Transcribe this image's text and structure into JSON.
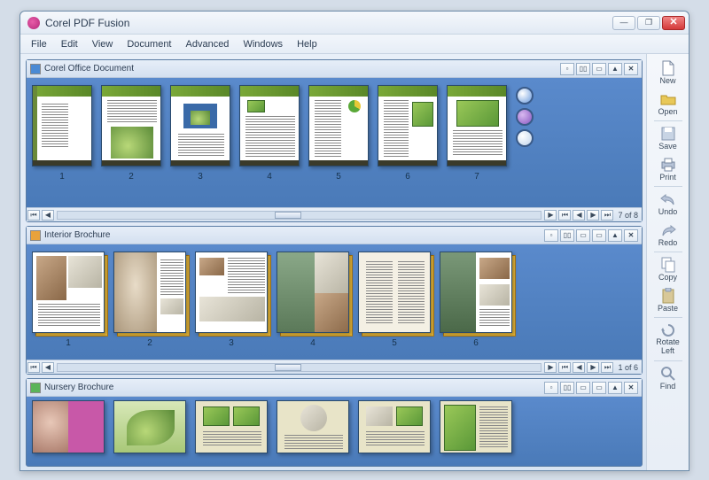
{
  "app": {
    "title": "Corel PDF Fusion"
  },
  "menu": [
    "File",
    "Edit",
    "View",
    "Document",
    "Advanced",
    "Windows",
    "Help"
  ],
  "sidebar": [
    {
      "label": "New",
      "icon": "file-new-icon"
    },
    {
      "label": "Open",
      "icon": "folder-open-icon"
    },
    {
      "label": "Save",
      "icon": "disk-icon"
    },
    {
      "label": "Print",
      "icon": "printer-icon"
    },
    {
      "label": "Undo",
      "icon": "undo-icon"
    },
    {
      "label": "Redo",
      "icon": "redo-icon"
    },
    {
      "label": "Copy",
      "icon": "copy-icon"
    },
    {
      "label": "Paste",
      "icon": "paste-icon"
    },
    {
      "label": "Rotate Left",
      "icon": "rotate-left-icon"
    },
    {
      "label": "Find",
      "icon": "find-icon"
    }
  ],
  "documents": [
    {
      "title": "Corel Office Document",
      "color": "blue",
      "pages": [
        "1",
        "2",
        "3",
        "4",
        "5",
        "6",
        "7"
      ],
      "pager": "7 of 8",
      "showViewBtns": true
    },
    {
      "title": "Interior Brochure",
      "color": "orange",
      "pages": [
        "1",
        "2",
        "3",
        "4",
        "5",
        "6"
      ],
      "pager": "1 of 6",
      "showViewBtns": false
    },
    {
      "title": "Nursery Brochure",
      "color": "green",
      "pages": [],
      "pager": "",
      "showViewBtns": false
    }
  ]
}
